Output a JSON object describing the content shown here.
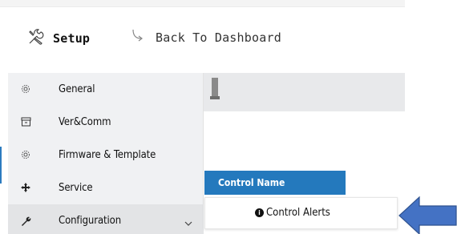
{
  "header": {
    "setup_label": "Setup",
    "back_label": "Back To Dashboard"
  },
  "menu": {
    "items": [
      {
        "label": "General",
        "icon": "gear-icon"
      },
      {
        "label": "Ver&Comm",
        "icon": "archive-icon"
      },
      {
        "label": "Firmware & Template",
        "icon": "gear-icon"
      },
      {
        "label": "Service",
        "icon": "move-icon"
      },
      {
        "label": "Configuration",
        "icon": "wrench-icon",
        "expandable": true
      }
    ]
  },
  "table": {
    "column_header": "Control Name",
    "row_label": "Control Alerts",
    "row_icon": "info-icon"
  },
  "colors": {
    "accent": "#2479bd",
    "arrow": "#4472c4",
    "menu_bg": "#f0f1f3"
  }
}
